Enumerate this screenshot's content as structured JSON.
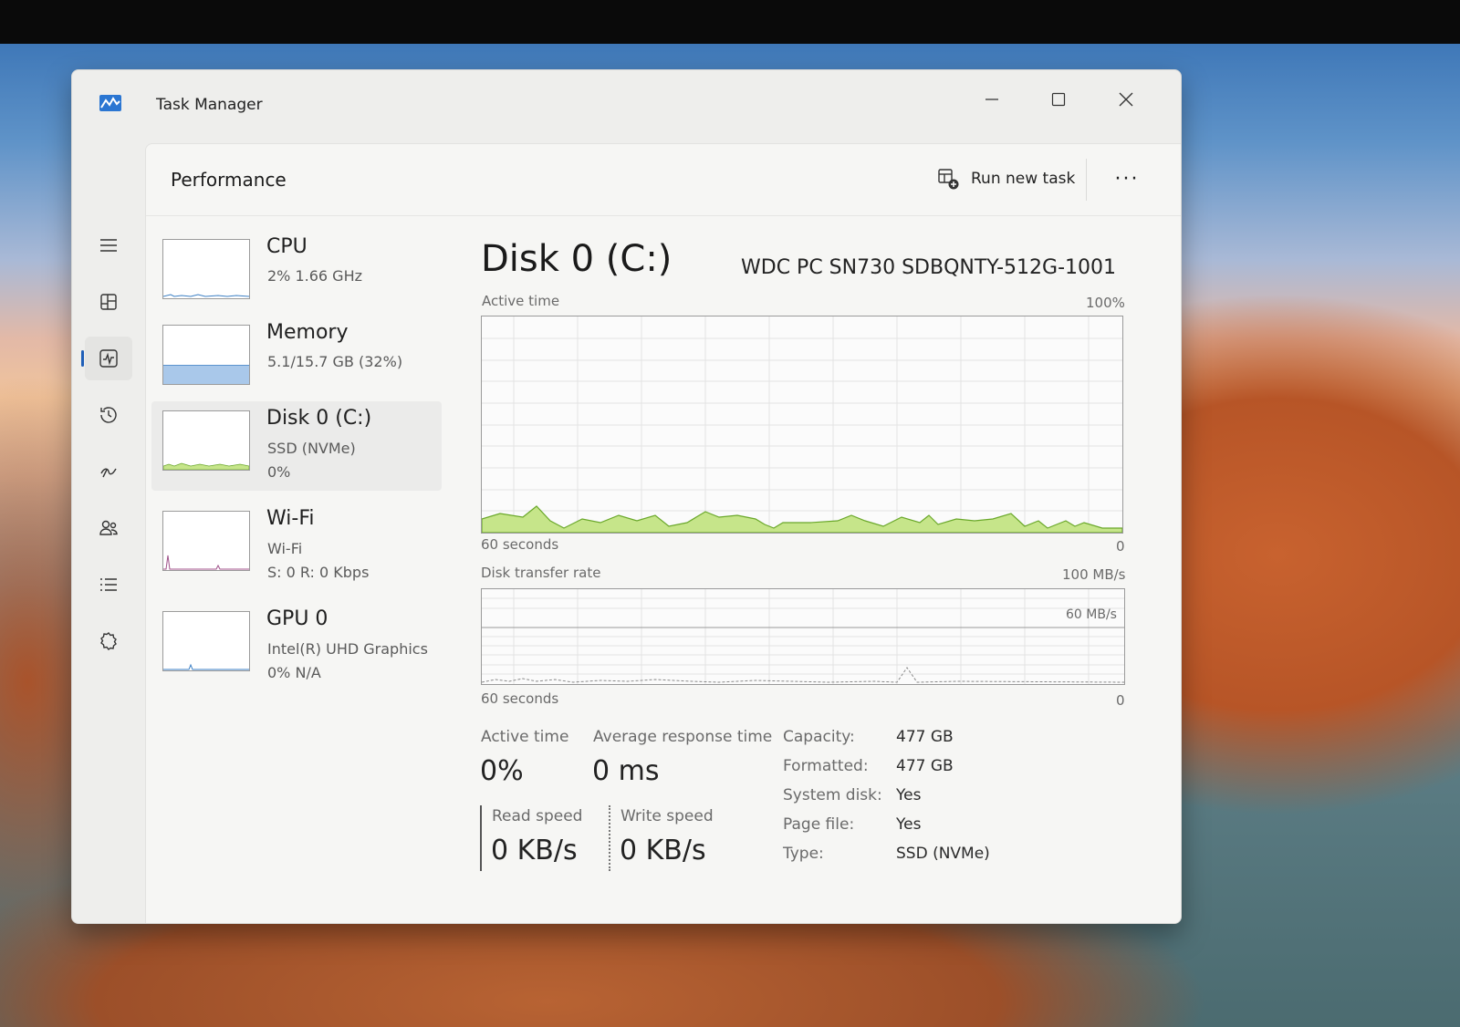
{
  "window": {
    "title": "Task Manager"
  },
  "nav": {
    "items": [
      {
        "icon": "hamburger-menu-icon"
      },
      {
        "icon": "processes-icon"
      },
      {
        "icon": "performance-icon",
        "active": true
      },
      {
        "icon": "app-history-icon"
      },
      {
        "icon": "startup-apps-icon"
      },
      {
        "icon": "users-icon"
      },
      {
        "icon": "details-icon"
      },
      {
        "icon": "services-icon"
      }
    ],
    "settings_icon": "settings-gear-icon"
  },
  "header": {
    "title": "Performance",
    "run_new_task_label": "Run new task",
    "more_label": "···"
  },
  "resources": [
    {
      "name": "CPU",
      "lines": [
        "2%  1.66 GHz"
      ]
    },
    {
      "name": "Memory",
      "lines": [
        "5.1/15.7 GB (32%)"
      ]
    },
    {
      "name": "Disk 0 (C:)",
      "lines": [
        "SSD (NVMe)",
        "0%"
      ],
      "selected": true
    },
    {
      "name": "Wi-Fi",
      "lines": [
        "Wi-Fi",
        "S: 0  R: 0 Kbps"
      ]
    },
    {
      "name": "GPU 0",
      "lines": [
        "Intel(R) UHD Graphics",
        "0%  N/A"
      ]
    }
  ],
  "detail": {
    "title": "Disk 0 (C:)",
    "model": "WDC PC SN730 SDBQNTY-512G-1001",
    "active_time_graph": {
      "label": "Active time",
      "max_label": "100%",
      "time_label": "60 seconds",
      "min_label": "0"
    },
    "transfer_graph": {
      "label": "Disk transfer rate",
      "max_label": "100 MB/s",
      "mid_label": "60 MB/s",
      "time_label": "60 seconds",
      "min_label": "0"
    },
    "stats": {
      "active_time_label": "Active time",
      "active_time_value": "0%",
      "avg_response_label": "Average response time",
      "avg_response_value": "0 ms",
      "read_speed_label": "Read speed",
      "read_speed_value": "0 KB/s",
      "write_speed_label": "Write speed",
      "write_speed_value": "0 KB/s"
    },
    "properties": [
      {
        "key": "Capacity:",
        "value": "477 GB"
      },
      {
        "key": "Formatted:",
        "value": "477 GB"
      },
      {
        "key": "System disk:",
        "value": "Yes"
      },
      {
        "key": "Page file:",
        "value": "Yes"
      },
      {
        "key": "Type:",
        "value": "SSD (NVMe)"
      }
    ]
  },
  "colors": {
    "disk_graph_fill": "#c6e58a",
    "disk_graph_line": "#6aa82a",
    "memory_fill": "#a9c8ea",
    "wifi_line": "#a0528a",
    "accent": "#1f5fb8"
  }
}
